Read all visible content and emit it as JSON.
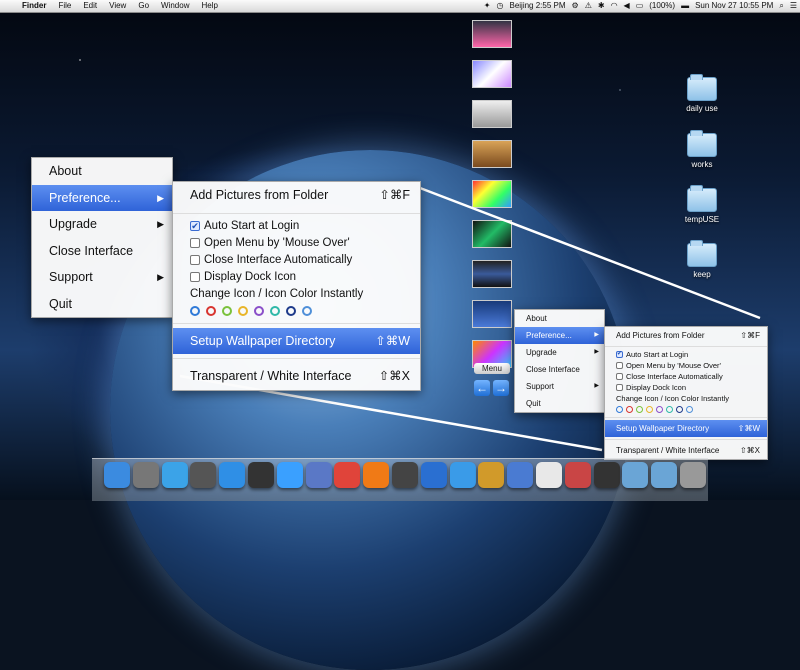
{
  "menubar": {
    "app": "Finder",
    "items": [
      "File",
      "Edit",
      "View",
      "Go",
      "Window",
      "Help"
    ],
    "status_clock_city": "Beijing 2:55 PM",
    "battery": "(100%)",
    "datetime": "Sun Nov 27  10:55 PM"
  },
  "folders": [
    {
      "label": "daily use"
    },
    {
      "label": "works"
    },
    {
      "label": "tempUSE"
    },
    {
      "label": "keep"
    }
  ],
  "strip": {
    "menu_label": "Menu"
  },
  "main_menu": {
    "items": [
      {
        "label": "About",
        "arrow": false
      },
      {
        "label": "Preference...",
        "arrow": true
      },
      {
        "label": "Upgrade",
        "arrow": true
      },
      {
        "label": "Close Interface",
        "arrow": false
      },
      {
        "label": "Support",
        "arrow": true
      },
      {
        "label": "Quit",
        "arrow": false
      }
    ],
    "selected_index": 1
  },
  "pref_menu": {
    "add_pictures": "Add Pictures from Folder",
    "add_pictures_shortcut": "⇧⌘F",
    "checks": [
      {
        "label": "Auto Start at Login",
        "checked": true
      },
      {
        "label": "Open Menu by 'Mouse Over'",
        "checked": false
      },
      {
        "label": "Close Interface Automatically",
        "checked": false
      },
      {
        "label": "Display Dock Icon",
        "checked": false
      }
    ],
    "change_icon": "Change Icon / Icon Color Instantly",
    "icon_colors": [
      "#2f7ad8",
      "#d8342f",
      "#7bc23c",
      "#e8b52a",
      "#8a4fc9",
      "#2fb8a8",
      "#1d3a8a",
      "#4f8fd8"
    ],
    "setup_wallpaper": "Setup Wallpaper Directory",
    "setup_wallpaper_shortcut": "⇧⌘W",
    "transparent": "Transparent / White Interface",
    "transparent_shortcut": "⇧⌘X"
  },
  "dock": {
    "icons": [
      {
        "name": "finder-icon",
        "color": "#3b8be0"
      },
      {
        "name": "launchpad-icon",
        "color": "#777"
      },
      {
        "name": "itunes-icon",
        "color": "#3ba3e8"
      },
      {
        "name": "photo-icon",
        "color": "#555"
      },
      {
        "name": "appstore-icon",
        "color": "#2f8fe6"
      },
      {
        "name": "dashboard-icon",
        "color": "#333"
      },
      {
        "name": "messenger-icon",
        "color": "#3aa0ff"
      },
      {
        "name": "mail-icon",
        "color": "#5a78c6"
      },
      {
        "name": "chrome-icon",
        "color": "#e0443a"
      },
      {
        "name": "firefox-icon",
        "color": "#f07a16"
      },
      {
        "name": "activity-monitor-icon",
        "color": "#444"
      },
      {
        "name": "google-earth-icon",
        "color": "#2a6fd1"
      },
      {
        "name": "safari-icon",
        "color": "#3a9be8"
      },
      {
        "name": "preview-icon",
        "color": "#d19a2a"
      },
      {
        "name": "xcode-icon",
        "color": "#4a7bd2"
      },
      {
        "name": "textedit-icon",
        "color": "#e8e8e8"
      },
      {
        "name": "rocket-icon",
        "color": "#c94545"
      },
      {
        "name": "zdock-icon",
        "color": "#333"
      },
      {
        "name": "applications-folder-icon",
        "color": "#6aa5d6"
      },
      {
        "name": "documents-folder-icon",
        "color": "#6aa5d6"
      },
      {
        "name": "trash-icon",
        "color": "#999"
      }
    ]
  }
}
